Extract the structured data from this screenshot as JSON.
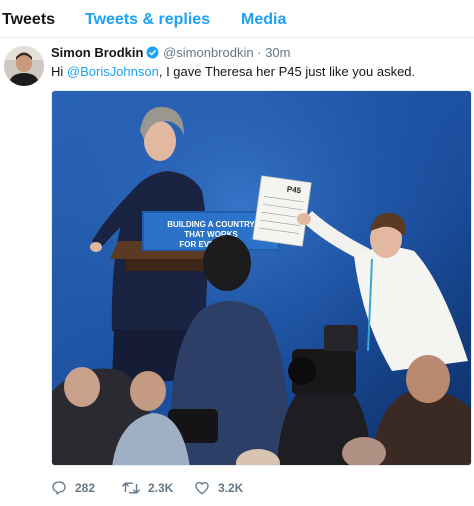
{
  "tabs": [
    {
      "label": "Tweets"
    },
    {
      "label": "Tweets & replies"
    },
    {
      "label": "Media"
    }
  ],
  "tweet": {
    "author_name": "Simon Brodkin",
    "handle": "@simonbrodkin",
    "separator": "·",
    "time": "30m",
    "text_before": "Hi ",
    "mention": "@BorisJohnson",
    "text_after": ", I gave Theresa her P45 just like you asked.",
    "photo": {
      "banner_text": "BUILDING A COUNTRY THAT WORKS FOR EVERYONE",
      "paper_text": "P45"
    }
  },
  "actions": {
    "reply_count": "282",
    "retweet_count": "2.3K",
    "like_count": "3.2K"
  },
  "colors": {
    "accent": "#1da1f2",
    "muted": "#657786",
    "text": "#14171a"
  }
}
